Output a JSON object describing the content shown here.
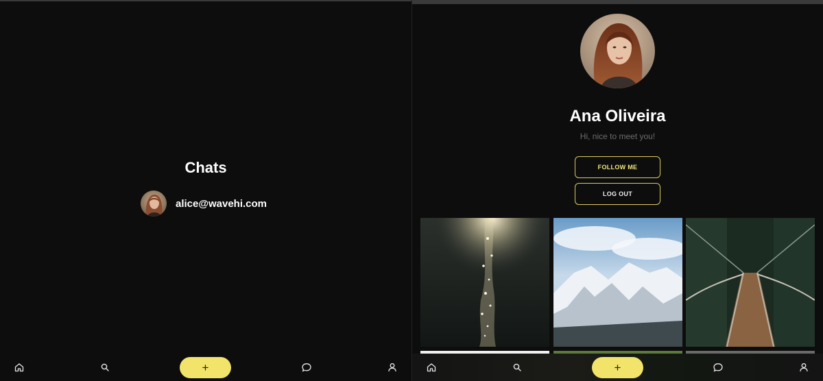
{
  "chats": {
    "title": "Chats",
    "items": [
      {
        "email": "alice@wavehi.com",
        "avatar": "avatar-woman-portrait"
      }
    ]
  },
  "profile": {
    "name": "Ana Oliveira",
    "bio": "Hi, nice to meet you!",
    "follow_label": "FOLLOW ME",
    "logout_label": "LOG OUT",
    "photos": [
      {
        "name": "sunlight-on-water-photo"
      },
      {
        "name": "snowy-mountains-photo"
      },
      {
        "name": "suspension-bridge-forest-photo"
      }
    ]
  },
  "nav": {
    "items": [
      "home-icon",
      "search-icon",
      "add-button",
      "chat-bubble-icon",
      "user-icon"
    ],
    "add_label": "+"
  },
  "colors": {
    "background": "#0d0d0d",
    "accent": "#f2e46a",
    "button_border": "#d8cc5e",
    "muted_text": "#6d6d6d"
  }
}
